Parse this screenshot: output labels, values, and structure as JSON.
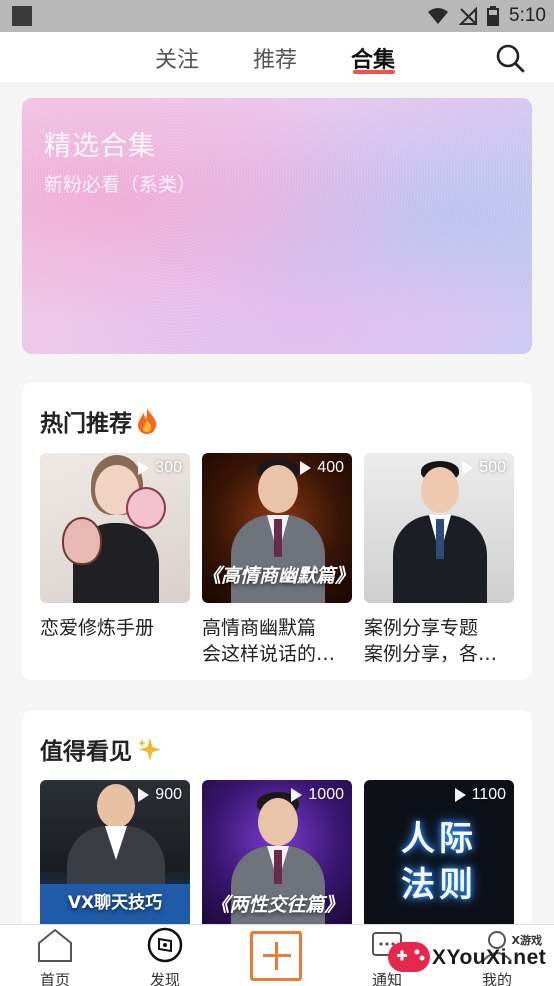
{
  "status": {
    "time": "5:10"
  },
  "tabs": [
    {
      "label": "关注",
      "active": false
    },
    {
      "label": "推荐",
      "active": false
    },
    {
      "label": "合集",
      "active": true
    }
  ],
  "banner": {
    "title": "精选合集",
    "subtitle": "新粉必看（系类）"
  },
  "hot": {
    "title": "热门推荐",
    "icon": "fire-icon",
    "items": [
      {
        "count": "300",
        "title": "恋爱修炼手册"
      },
      {
        "count": "400",
        "title": "高情商幽默篇",
        "subtitle": "会这样说话的人...",
        "overlay": "《高情商幽默篇》"
      },
      {
        "count": "500",
        "title": "案例分享专题",
        "subtitle": "案例分享，各种..."
      }
    ]
  },
  "worth": {
    "title": "值得看见",
    "icon": "sparkle-icon",
    "items": [
      {
        "count": "900",
        "overlay": "VX聊天技巧"
      },
      {
        "count": "1000",
        "overlay": "《两性交往篇》"
      },
      {
        "count": "1100",
        "overlay": "人际法则"
      }
    ]
  },
  "bottom_nav": [
    {
      "label": "首页",
      "icon": "home-icon"
    },
    {
      "label": "发现",
      "icon": "compass-icon"
    },
    {
      "label": "",
      "icon": "plus-icon"
    },
    {
      "label": "通知",
      "icon": "message-icon"
    },
    {
      "label": "我的",
      "icon": "profile-icon"
    }
  ],
  "watermark": {
    "text": "XYouXi.net",
    "small": "X游戏"
  },
  "colors": {
    "accent": "#f0504e",
    "plus": "#ee7a3a"
  }
}
